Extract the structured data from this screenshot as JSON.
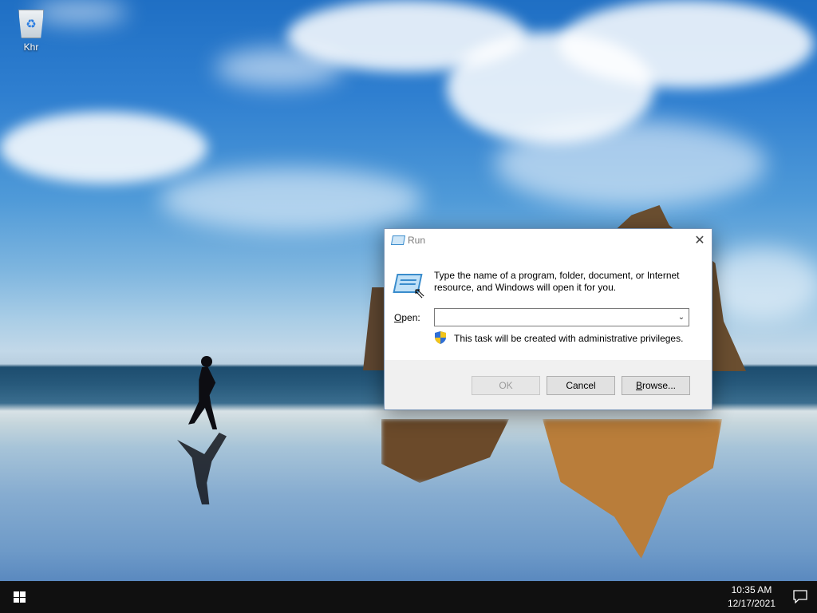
{
  "desktop": {
    "icons": [
      {
        "label": "Khr",
        "icon": "recycle-bin-icon"
      }
    ]
  },
  "run_dialog": {
    "title": "Run",
    "description": "Type the name of a program, folder, document, or Internet resource, and Windows will open it for you.",
    "open_label_accel": "O",
    "open_label_rest": "pen:",
    "open_value": "",
    "admin_note": "This task will be created with administrative privileges.",
    "buttons": {
      "ok": "OK",
      "cancel": "Cancel",
      "browse_accel": "B",
      "browse_rest": "rowse..."
    },
    "ok_enabled": false,
    "accent_color": "#3a8ccc"
  },
  "taskbar": {
    "time": "10:35 AM",
    "date": "12/17/2021",
    "background": "#101010"
  }
}
